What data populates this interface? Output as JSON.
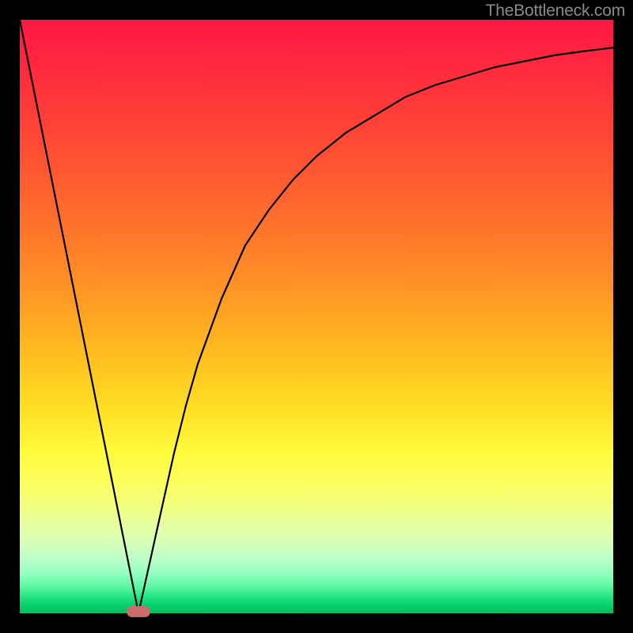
{
  "watermark": "TheBottleneck.com",
  "colors": {
    "frame_border": "#000000",
    "curve": "#000000",
    "marker": "#cc6b6b",
    "gradient_top": "#ff1744",
    "gradient_bottom": "#00c060"
  },
  "chart_data": {
    "type": "line",
    "title": "",
    "xlabel": "",
    "ylabel": "",
    "xlim": [
      0,
      100
    ],
    "ylim": [
      0,
      100
    ],
    "grid": false,
    "series": [
      {
        "name": "bottleneck-curve",
        "x": [
          0,
          2,
          4,
          6,
          8,
          10,
          12,
          14,
          16,
          18,
          20,
          22,
          24,
          26,
          28,
          30,
          34,
          38,
          42,
          46,
          50,
          55,
          60,
          65,
          70,
          75,
          80,
          85,
          90,
          95,
          100
        ],
        "values": [
          100,
          90,
          80,
          70,
          60,
          50,
          40,
          30,
          20,
          10,
          0,
          9,
          18,
          27,
          35,
          42,
          53,
          62,
          68,
          73,
          77,
          81,
          84,
          87,
          89,
          90.5,
          92,
          93,
          94,
          94.7,
          95.3
        ]
      }
    ],
    "annotations": [
      {
        "name": "optimal-marker",
        "x": 20,
        "y": 0
      }
    ],
    "gradient": {
      "description": "vertical heat gradient red (top / high bottleneck) to green (bottom / low bottleneck)"
    }
  }
}
